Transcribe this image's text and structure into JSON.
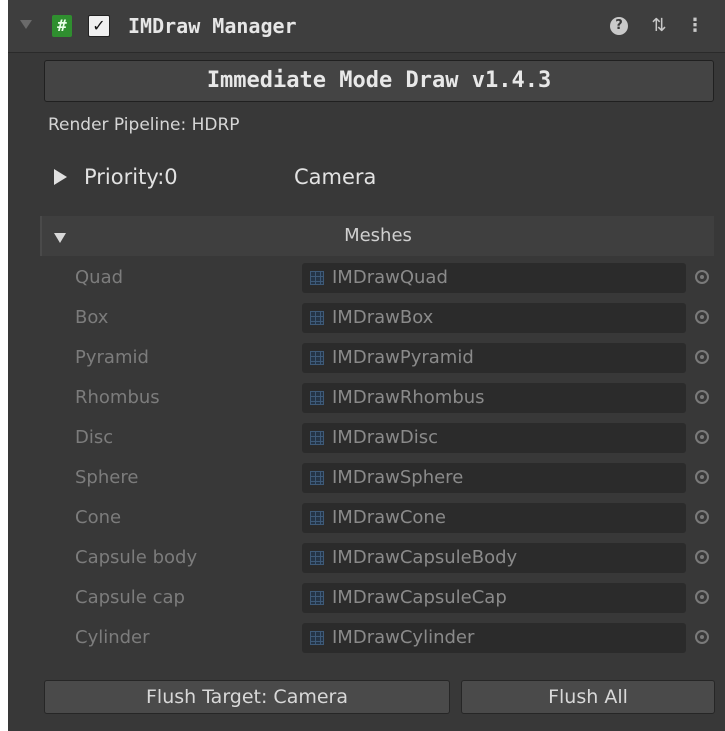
{
  "header": {
    "script_icon": "#",
    "enabled_check": "✓",
    "title": "IMDraw Manager",
    "help_icon": "?",
    "presets_icon": "⇅",
    "more_icon": "⋮"
  },
  "version_label": "Immediate Mode Draw v1.4.3",
  "render_pipeline": "Render Pipeline: HDRP",
  "priority": {
    "label": "Priority:0",
    "value": "Camera"
  },
  "meshes": {
    "title": "Meshes",
    "rows": [
      {
        "label": "Quad",
        "value": "IMDrawQuad"
      },
      {
        "label": "Box",
        "value": "IMDrawBox"
      },
      {
        "label": "Pyramid",
        "value": "IMDrawPyramid"
      },
      {
        "label": "Rhombus",
        "value": "IMDrawRhombus"
      },
      {
        "label": "Disc",
        "value": "IMDrawDisc"
      },
      {
        "label": "Sphere",
        "value": "IMDrawSphere"
      },
      {
        "label": "Cone",
        "value": "IMDrawCone"
      },
      {
        "label": "Capsule body",
        "value": "IMDrawCapsuleBody"
      },
      {
        "label": "Capsule cap",
        "value": "IMDrawCapsuleCap"
      },
      {
        "label": "Cylinder",
        "value": "IMDrawCylinder"
      }
    ]
  },
  "buttons": {
    "flush_target": "Flush Target: Camera",
    "flush_all": "Flush All"
  },
  "colors": {
    "panel_bg": "#383838",
    "field_bg": "#2b2b2b",
    "script_icon": "#2f8f2f"
  }
}
